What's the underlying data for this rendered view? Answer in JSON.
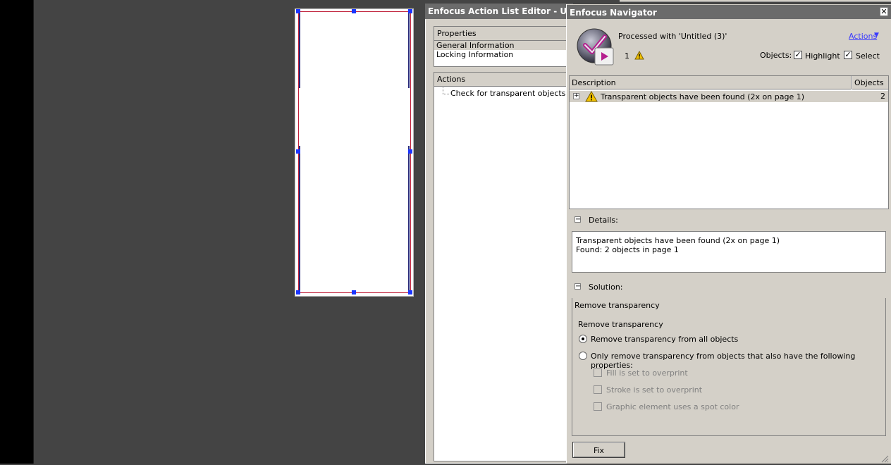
{
  "action_list_editor": {
    "title": "Enfocus Action List Editor - Untitled",
    "properties_header": "Properties",
    "properties": [
      "General Information",
      "Locking Information"
    ],
    "actions_header": "Actions",
    "action_item": "Check for transparent objects"
  },
  "navigator": {
    "title": "Enfocus Navigator",
    "close_glyph": "✕",
    "processed_text": "Processed with 'Untitled (3)'",
    "actions_link": "Actions",
    "warning_count": "1",
    "objects_label": "Objects:",
    "highlight_label": "Highlight",
    "highlight_checked": true,
    "select_label": "Select",
    "select_checked": true,
    "list": {
      "col_description": "Description",
      "col_objects": "Objects",
      "rows": [
        {
          "description": "Transparent objects have been found (2x on page 1)",
          "objects": "2"
        }
      ]
    },
    "details_label": "Details:",
    "details_lines": [
      "Transparent objects have been found (2x on page 1)",
      "Found: 2 objects in page 1"
    ],
    "solution_label": "Solution:",
    "solution_title": "Remove transparency",
    "solution_subtitle": "Remove transparency",
    "radio_all": "Remove transparency from all objects",
    "radio_only": "Only remove transparency from objects that also have the following properties:",
    "opt_fill": "Fill is set to overprint",
    "opt_stroke": "Stroke is set to overprint",
    "opt_spot": "Graphic element uses a spot color",
    "fix_label": "Fix"
  },
  "colors": {
    "title_bar": "#6b6b6b",
    "panel": "#d4d0c8",
    "selection_outline": "#c0203a",
    "handle": "#1a35ff",
    "link": "#3a3aff",
    "warning": "#f2c200"
  }
}
